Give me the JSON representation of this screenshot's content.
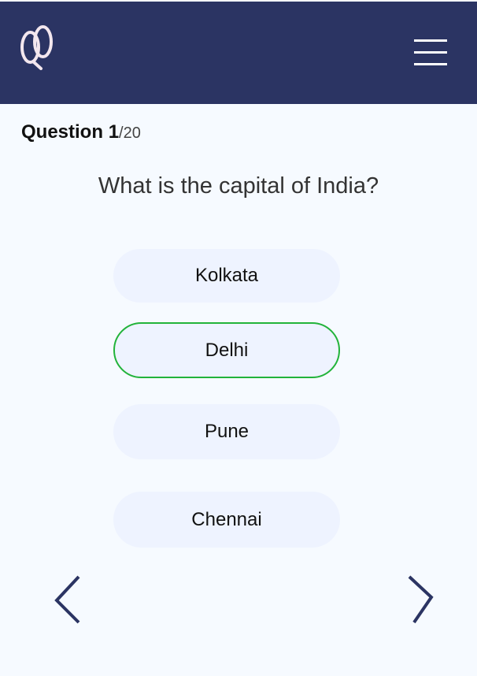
{
  "header": {
    "logo_icon": "quiz-logo-icon",
    "menu_icon": "hamburger-menu-icon",
    "background_color": "#2b3463"
  },
  "progress": {
    "label": "Question",
    "current": "1",
    "total": "/20"
  },
  "question": {
    "text": "What is the capital of India?"
  },
  "options": [
    {
      "label": "Kolkata",
      "selected": false
    },
    {
      "label": "Delhi",
      "selected": true
    },
    {
      "label": "Pune",
      "selected": false
    },
    {
      "label": "Chennai",
      "selected": false
    }
  ],
  "navigation": {
    "prev_icon": "chevron-left-icon",
    "next_icon": "chevron-right-icon",
    "color": "#2b3463"
  },
  "colors": {
    "selected_border": "#22b33a",
    "option_background": "#eef3ff"
  }
}
